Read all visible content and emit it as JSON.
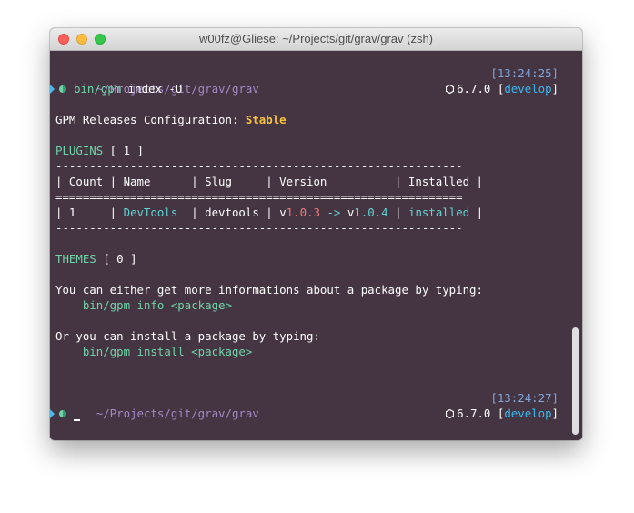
{
  "window": {
    "title": "w00fz@Gliese: ~/Projects/git/grav/grav (zsh)"
  },
  "prompt1": {
    "path": "~/Projects/git/grav/grav",
    "time": "[13:24:25]",
    "command": "bin/gpm",
    "args": " index -U",
    "version": "6.7.0",
    "branch_open": " [",
    "branch": "develop",
    "branch_close": "]"
  },
  "output": {
    "config_label": "GPM Releases Configuration: ",
    "config_value": "Stable",
    "plugins_label": "PLUGINS",
    "plugins_count": " [ 1 ]",
    "separator": "------------------------------------------------------------",
    "header_sep": "============================================================",
    "table_header": "| Count | Name      | Slug     | Version          | Installed |",
    "row": {
      "count": "| 1     | ",
      "name": "DevTools",
      "slug_part": "  | devtools | ",
      "v_prefix1": "v",
      "from_version": "1.0.3",
      "arrow": " -> ",
      "v_prefix2": "v",
      "to_version": "1.0.4",
      "mid_sep": " | ",
      "installed": "installed",
      "end": " |"
    },
    "themes_label": "THEMES",
    "themes_count": " [ 0 ]",
    "info_text": "You can either get more informations about a package by typing:",
    "info_cmd": "    bin/gpm info ",
    "info_arg": "<package>",
    "install_text": "Or you can install a package by typing:",
    "install_cmd": "    bin/gpm install ",
    "install_arg": "<package>"
  },
  "prompt2": {
    "path": "~/Projects/git/grav/grav",
    "time": "[13:24:27]",
    "version": "6.7.0",
    "branch_open": " [",
    "branch": "develop",
    "branch_close": "]"
  }
}
